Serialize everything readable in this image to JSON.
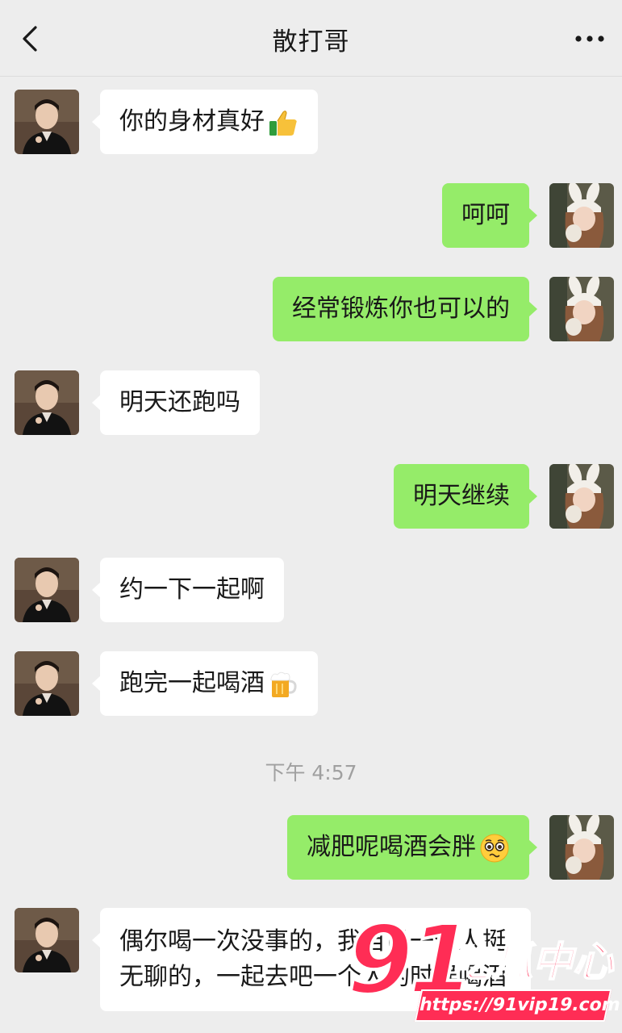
{
  "header": {
    "title": "散打哥",
    "back_icon": "chevron-left-icon",
    "more_icon": "more-dots-icon"
  },
  "messages": [
    {
      "side": "left",
      "text": "你的身材真好",
      "emoji": "thumbs-up-icon"
    },
    {
      "side": "right",
      "text": "呵呵"
    },
    {
      "side": "right",
      "text": "经常锻炼你也可以的"
    },
    {
      "side": "left",
      "text": "明天还跑吗"
    },
    {
      "side": "right",
      "text": "明天继续"
    },
    {
      "side": "left",
      "text": "约一下一起啊"
    },
    {
      "side": "left",
      "text": "跑完一起喝酒",
      "emoji": "beer-mug-icon"
    },
    {
      "side": "right",
      "text": "减肥呢喝酒会胖",
      "emoji": "pleading-face-icon"
    },
    {
      "side": "left",
      "text": "偶尔喝一次没事的，我自己一个人挺无聊的，一起去吧一个人的时候喝酒"
    }
  ],
  "timestamp": "下午 4:57",
  "watermark": {
    "number": "91",
    "name": "吃瓜中心",
    "url": "https://91vip19.com"
  },
  "colors": {
    "background": "#ededed",
    "bubble_sent": "#95ec69",
    "bubble_received": "#ffffff",
    "watermark": "#ff2d55"
  }
}
